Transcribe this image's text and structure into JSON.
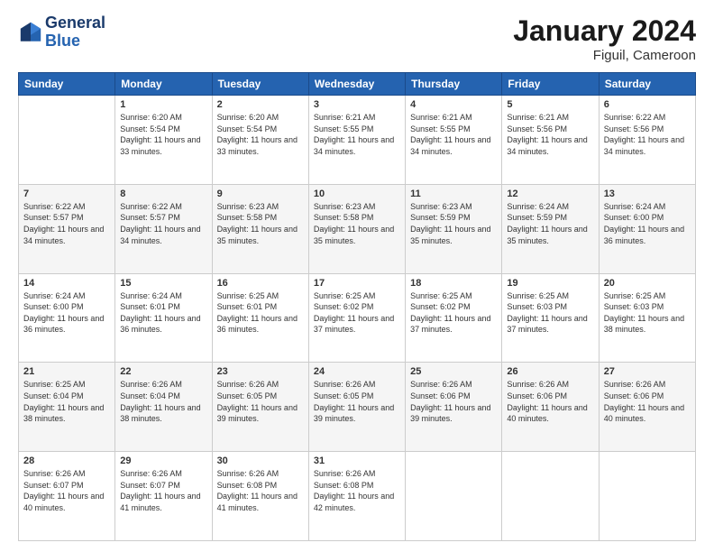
{
  "header": {
    "logo_line1": "General",
    "logo_line2": "Blue",
    "main_title": "January 2024",
    "subtitle": "Figuil, Cameroon"
  },
  "days_of_week": [
    "Sunday",
    "Monday",
    "Tuesday",
    "Wednesday",
    "Thursday",
    "Friday",
    "Saturday"
  ],
  "weeks": [
    [
      {
        "day": "",
        "sunrise": "",
        "sunset": "",
        "daylight": ""
      },
      {
        "day": "1",
        "sunrise": "Sunrise: 6:20 AM",
        "sunset": "Sunset: 5:54 PM",
        "daylight": "Daylight: 11 hours and 33 minutes."
      },
      {
        "day": "2",
        "sunrise": "Sunrise: 6:20 AM",
        "sunset": "Sunset: 5:54 PM",
        "daylight": "Daylight: 11 hours and 33 minutes."
      },
      {
        "day": "3",
        "sunrise": "Sunrise: 6:21 AM",
        "sunset": "Sunset: 5:55 PM",
        "daylight": "Daylight: 11 hours and 34 minutes."
      },
      {
        "day": "4",
        "sunrise": "Sunrise: 6:21 AM",
        "sunset": "Sunset: 5:55 PM",
        "daylight": "Daylight: 11 hours and 34 minutes."
      },
      {
        "day": "5",
        "sunrise": "Sunrise: 6:21 AM",
        "sunset": "Sunset: 5:56 PM",
        "daylight": "Daylight: 11 hours and 34 minutes."
      },
      {
        "day": "6",
        "sunrise": "Sunrise: 6:22 AM",
        "sunset": "Sunset: 5:56 PM",
        "daylight": "Daylight: 11 hours and 34 minutes."
      }
    ],
    [
      {
        "day": "7",
        "sunrise": "Sunrise: 6:22 AM",
        "sunset": "Sunset: 5:57 PM",
        "daylight": "Daylight: 11 hours and 34 minutes."
      },
      {
        "day": "8",
        "sunrise": "Sunrise: 6:22 AM",
        "sunset": "Sunset: 5:57 PM",
        "daylight": "Daylight: 11 hours and 34 minutes."
      },
      {
        "day": "9",
        "sunrise": "Sunrise: 6:23 AM",
        "sunset": "Sunset: 5:58 PM",
        "daylight": "Daylight: 11 hours and 35 minutes."
      },
      {
        "day": "10",
        "sunrise": "Sunrise: 6:23 AM",
        "sunset": "Sunset: 5:58 PM",
        "daylight": "Daylight: 11 hours and 35 minutes."
      },
      {
        "day": "11",
        "sunrise": "Sunrise: 6:23 AM",
        "sunset": "Sunset: 5:59 PM",
        "daylight": "Daylight: 11 hours and 35 minutes."
      },
      {
        "day": "12",
        "sunrise": "Sunrise: 6:24 AM",
        "sunset": "Sunset: 5:59 PM",
        "daylight": "Daylight: 11 hours and 35 minutes."
      },
      {
        "day": "13",
        "sunrise": "Sunrise: 6:24 AM",
        "sunset": "Sunset: 6:00 PM",
        "daylight": "Daylight: 11 hours and 36 minutes."
      }
    ],
    [
      {
        "day": "14",
        "sunrise": "Sunrise: 6:24 AM",
        "sunset": "Sunset: 6:00 PM",
        "daylight": "Daylight: 11 hours and 36 minutes."
      },
      {
        "day": "15",
        "sunrise": "Sunrise: 6:24 AM",
        "sunset": "Sunset: 6:01 PM",
        "daylight": "Daylight: 11 hours and 36 minutes."
      },
      {
        "day": "16",
        "sunrise": "Sunrise: 6:25 AM",
        "sunset": "Sunset: 6:01 PM",
        "daylight": "Daylight: 11 hours and 36 minutes."
      },
      {
        "day": "17",
        "sunrise": "Sunrise: 6:25 AM",
        "sunset": "Sunset: 6:02 PM",
        "daylight": "Daylight: 11 hours and 37 minutes."
      },
      {
        "day": "18",
        "sunrise": "Sunrise: 6:25 AM",
        "sunset": "Sunset: 6:02 PM",
        "daylight": "Daylight: 11 hours and 37 minutes."
      },
      {
        "day": "19",
        "sunrise": "Sunrise: 6:25 AM",
        "sunset": "Sunset: 6:03 PM",
        "daylight": "Daylight: 11 hours and 37 minutes."
      },
      {
        "day": "20",
        "sunrise": "Sunrise: 6:25 AM",
        "sunset": "Sunset: 6:03 PM",
        "daylight": "Daylight: 11 hours and 38 minutes."
      }
    ],
    [
      {
        "day": "21",
        "sunrise": "Sunrise: 6:25 AM",
        "sunset": "Sunset: 6:04 PM",
        "daylight": "Daylight: 11 hours and 38 minutes."
      },
      {
        "day": "22",
        "sunrise": "Sunrise: 6:26 AM",
        "sunset": "Sunset: 6:04 PM",
        "daylight": "Daylight: 11 hours and 38 minutes."
      },
      {
        "day": "23",
        "sunrise": "Sunrise: 6:26 AM",
        "sunset": "Sunset: 6:05 PM",
        "daylight": "Daylight: 11 hours and 39 minutes."
      },
      {
        "day": "24",
        "sunrise": "Sunrise: 6:26 AM",
        "sunset": "Sunset: 6:05 PM",
        "daylight": "Daylight: 11 hours and 39 minutes."
      },
      {
        "day": "25",
        "sunrise": "Sunrise: 6:26 AM",
        "sunset": "Sunset: 6:06 PM",
        "daylight": "Daylight: 11 hours and 39 minutes."
      },
      {
        "day": "26",
        "sunrise": "Sunrise: 6:26 AM",
        "sunset": "Sunset: 6:06 PM",
        "daylight": "Daylight: 11 hours and 40 minutes."
      },
      {
        "day": "27",
        "sunrise": "Sunrise: 6:26 AM",
        "sunset": "Sunset: 6:06 PM",
        "daylight": "Daylight: 11 hours and 40 minutes."
      }
    ],
    [
      {
        "day": "28",
        "sunrise": "Sunrise: 6:26 AM",
        "sunset": "Sunset: 6:07 PM",
        "daylight": "Daylight: 11 hours and 40 minutes."
      },
      {
        "day": "29",
        "sunrise": "Sunrise: 6:26 AM",
        "sunset": "Sunset: 6:07 PM",
        "daylight": "Daylight: 11 hours and 41 minutes."
      },
      {
        "day": "30",
        "sunrise": "Sunrise: 6:26 AM",
        "sunset": "Sunset: 6:08 PM",
        "daylight": "Daylight: 11 hours and 41 minutes."
      },
      {
        "day": "31",
        "sunrise": "Sunrise: 6:26 AM",
        "sunset": "Sunset: 6:08 PM",
        "daylight": "Daylight: 11 hours and 42 minutes."
      },
      {
        "day": "",
        "sunrise": "",
        "sunset": "",
        "daylight": ""
      },
      {
        "day": "",
        "sunrise": "",
        "sunset": "",
        "daylight": ""
      },
      {
        "day": "",
        "sunrise": "",
        "sunset": "",
        "daylight": ""
      }
    ]
  ]
}
